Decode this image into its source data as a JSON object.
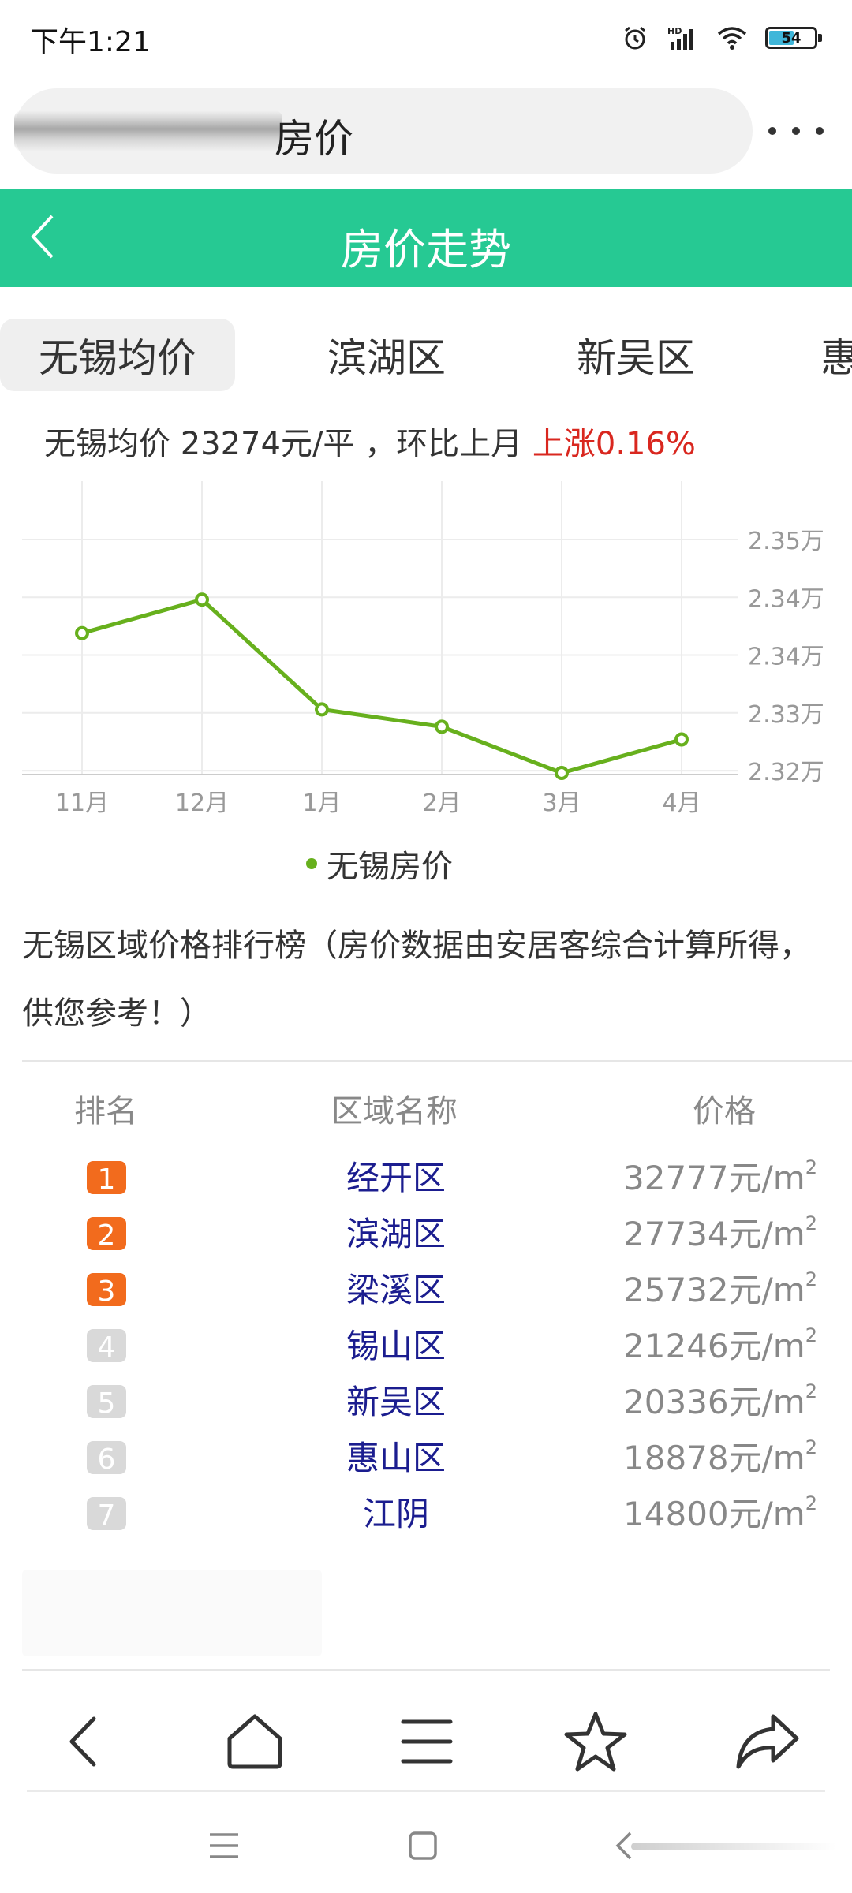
{
  "status_bar": {
    "time": "下午1:21",
    "battery": "54",
    "battery_level": 0.54,
    "icons": [
      "alarm-icon",
      "hd-signal-icon",
      "wifi-icon",
      "battery-icon"
    ]
  },
  "address_bar": {
    "text": "房价",
    "more_icon": "more-dots-icon"
  },
  "header": {
    "title": "房价走势",
    "back_icon": "back-chevron-icon",
    "color": "#26c993"
  },
  "tabs": [
    {
      "label": "无锡均价",
      "active": true
    },
    {
      "label": "滨湖区",
      "active": false
    },
    {
      "label": "新吴区",
      "active": false
    },
    {
      "label": "惠",
      "active": false
    }
  ],
  "summary": {
    "prefix": "无锡均价 23274元/平 ，环比上月 ",
    "change": "上涨0.16%",
    "change_color": "#d9271f"
  },
  "chart_data": {
    "type": "line",
    "categories": [
      "11月",
      "12月",
      "1月",
      "2月",
      "3月",
      "4月"
    ],
    "series": [
      {
        "name": "无锡房价",
        "color": "#67b01d",
        "values": [
          23369,
          23398,
          23303,
          23288,
          23248,
          23277
        ]
      }
    ],
    "y_ticks": [
      23250,
      23300,
      23350,
      23400,
      23450
    ],
    "y_tick_labels": [
      "2.32万",
      "2.33万",
      "2.34万",
      "2.34万",
      "2.35万"
    ],
    "ylim": [
      23248,
      23450
    ],
    "grid": true,
    "legend": "bottom-center"
  },
  "ranking": {
    "intro": "无锡区域价格排行榜（房价数据由安居客综合计算所得，供您参考！）",
    "headers": {
      "rank": "排名",
      "district": "区域名称",
      "price": "价格"
    },
    "unit_suffix": "元/m",
    "unit_sup": "2",
    "rows": [
      {
        "rank": "1",
        "district": "经开区",
        "price": "32777"
      },
      {
        "rank": "2",
        "district": "滨湖区",
        "price": "27734"
      },
      {
        "rank": "3",
        "district": "梁溪区",
        "price": "25732"
      },
      {
        "rank": "4",
        "district": "锡山区",
        "price": "21246"
      },
      {
        "rank": "5",
        "district": "新吴区",
        "price": "20336"
      },
      {
        "rank": "6",
        "district": "惠山区",
        "price": "18878"
      },
      {
        "rank": "7",
        "district": "江阴",
        "price": "14800"
      }
    ],
    "top_color": "#f26b1d",
    "rest_color": "#d9d9d9",
    "district_color": "#1b1d8f"
  },
  "toolbar": {
    "icons": [
      "back-arrow-icon",
      "home-icon",
      "menu-icon",
      "star-icon",
      "share-icon"
    ]
  },
  "system_nav": {
    "icons": [
      "recents-icon",
      "home-square-icon",
      "back-icon"
    ]
  }
}
